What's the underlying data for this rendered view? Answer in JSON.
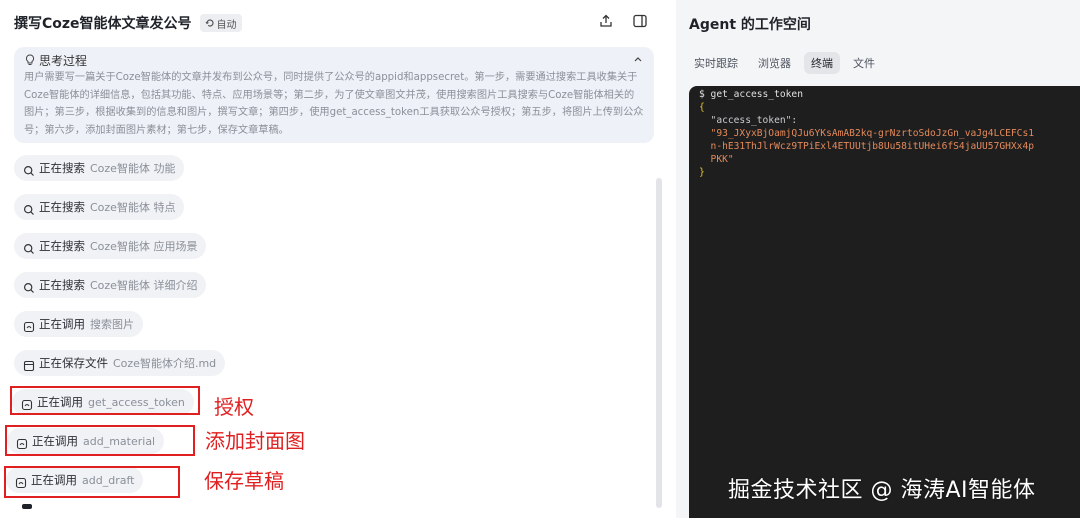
{
  "header": {
    "title": "撰写Coze智能体文章发公号",
    "badge": "自动"
  },
  "thinking": {
    "heading": "思考过程",
    "text": "用户需要写一篇关于Coze智能体的文章并发布到公众号，同时提供了公众号的appid和appsecret。第一步，需要通过搜索工具收集关于Coze智能体的详细信息，包括其功能、特点、应用场景等；第二步，为了使文章图文并茂，使用搜索图片工具搜索与Coze智能体相关的图片；第三步，根据收集到的信息和图片，撰写文章；第四步，使用get_access_token工具获取公众号授权；第五步，将图片上传到公众号；第六步，添加封面图片素材；第七步，保存文章草稿。"
  },
  "steps": [
    {
      "action": "正在搜索",
      "target": "Coze智能体 功能",
      "icon": "search-icon"
    },
    {
      "action": "正在搜索",
      "target": "Coze智能体 特点",
      "icon": "search-icon"
    },
    {
      "action": "正在搜索",
      "target": "Coze智能体 应用场景",
      "icon": "search-icon"
    },
    {
      "action": "正在搜索",
      "target": "Coze智能体 详细介绍",
      "icon": "search-icon"
    },
    {
      "action": "正在调用",
      "target": "搜索图片",
      "icon": "tool-icon"
    },
    {
      "action": "正在保存文件",
      "target": "Coze智能体介绍.md",
      "icon": "file-icon"
    },
    {
      "action": "正在调用",
      "target": "get_access_token",
      "icon": "tool-icon"
    },
    {
      "action": "正在调用",
      "target": "add_material",
      "icon": "tool-icon"
    },
    {
      "action": "正在调用",
      "target": "add_draft",
      "icon": "tool-icon"
    }
  ],
  "annotations": [
    "授权",
    "添加封面图",
    "保存草稿"
  ],
  "workspace": {
    "title": "Agent 的工作空间",
    "tabs": [
      "实时跟踪",
      "浏览器",
      "终端",
      "文件"
    ],
    "active_tab": "终端"
  },
  "terminal": {
    "lines": [
      {
        "text": "$ get_access_token",
        "kind": "cmd"
      },
      {
        "text": "{",
        "kind": "brace"
      },
      {
        "text": "  \"access_token\":",
        "kind": "key"
      },
      {
        "text": "  \"93_JXyxBjOamjQJu6YKsAmAB2kq-grNzrtoSdoJzGn_vaJg4LCEFCs1",
        "kind": "val"
      },
      {
        "text": "  n-hE31ThJlrWcz9TPiExl4ETUUtjb8Uu58itUHei6fS4jaUU57GHXx4p",
        "kind": "val"
      },
      {
        "text": "  PKK\"",
        "kind": "val"
      },
      {
        "text": "}",
        "kind": "brace"
      }
    ]
  },
  "watermark": "掘金技术社区 @ 海涛AI智能体",
  "colors": {
    "annotation_red": "#e02020",
    "terminal_bg": "#1e1e1e",
    "terminal_string": "#e48a5b",
    "terminal_brace": "#e6c229"
  }
}
